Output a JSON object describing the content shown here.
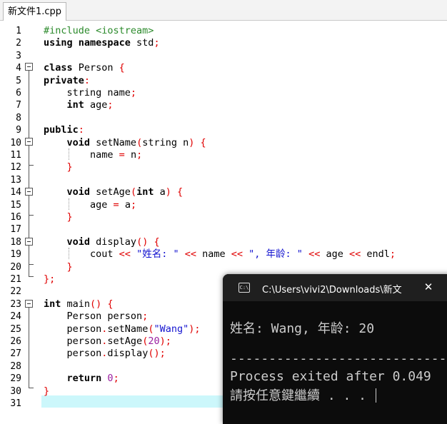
{
  "tab": {
    "title": "新文件1.cpp"
  },
  "lines": [
    {
      "n": "1",
      "tokens": [
        [
          "pp",
          "#include <iostream>"
        ]
      ]
    },
    {
      "n": "2",
      "tokens": [
        [
          "kw",
          "using namespace"
        ],
        [
          "plain",
          " std"
        ],
        [
          "op",
          ";"
        ]
      ]
    },
    {
      "n": "3",
      "tokens": []
    },
    {
      "n": "4",
      "tokens": [
        [
          "kw",
          "class"
        ],
        [
          "plain",
          " Person "
        ],
        [
          "op",
          "{"
        ]
      ]
    },
    {
      "n": "5",
      "tokens": [
        [
          "kw",
          "private"
        ],
        [
          "op",
          ":"
        ]
      ]
    },
    {
      "n": "6",
      "tokens": [
        [
          "plain",
          "    string name"
        ],
        [
          "op",
          ";"
        ]
      ]
    },
    {
      "n": "7",
      "tokens": [
        [
          "kw",
          "    int"
        ],
        [
          "plain",
          " age"
        ],
        [
          "op",
          ";"
        ]
      ]
    },
    {
      "n": "8",
      "tokens": []
    },
    {
      "n": "9",
      "tokens": [
        [
          "kw",
          "public"
        ],
        [
          "op",
          ":"
        ]
      ]
    },
    {
      "n": "10",
      "tokens": [
        [
          "kw",
          "    void"
        ],
        [
          "plain",
          " setName"
        ],
        [
          "op",
          "("
        ],
        [
          "plain",
          "string n"
        ],
        [
          "op",
          ") {"
        ]
      ]
    },
    {
      "n": "11",
      "tokens": [
        [
          "plain",
          "        name "
        ],
        [
          "op",
          "="
        ],
        [
          "plain",
          " n"
        ],
        [
          "op",
          ";"
        ]
      ]
    },
    {
      "n": "12",
      "tokens": [
        [
          "op",
          "    }"
        ]
      ]
    },
    {
      "n": "13",
      "tokens": []
    },
    {
      "n": "14",
      "tokens": [
        [
          "kw",
          "    void"
        ],
        [
          "plain",
          " setAge"
        ],
        [
          "op",
          "("
        ],
        [
          "kw",
          "int"
        ],
        [
          "plain",
          " a"
        ],
        [
          "op",
          ") {"
        ]
      ]
    },
    {
      "n": "15",
      "tokens": [
        [
          "plain",
          "        age "
        ],
        [
          "op",
          "="
        ],
        [
          "plain",
          " a"
        ],
        [
          "op",
          ";"
        ]
      ]
    },
    {
      "n": "16",
      "tokens": [
        [
          "op",
          "    }"
        ]
      ]
    },
    {
      "n": "17",
      "tokens": []
    },
    {
      "n": "18",
      "tokens": [
        [
          "kw",
          "    void"
        ],
        [
          "plain",
          " display"
        ],
        [
          "op",
          "() {"
        ]
      ]
    },
    {
      "n": "19",
      "tokens": [
        [
          "plain",
          "        cout "
        ],
        [
          "op",
          "<<"
        ],
        [
          "str",
          " \"姓名: \" "
        ],
        [
          "op",
          "<<"
        ],
        [
          "plain",
          " name "
        ],
        [
          "op",
          "<<"
        ],
        [
          "str",
          " \", 年龄: \" "
        ],
        [
          "op",
          "<<"
        ],
        [
          "plain",
          " age "
        ],
        [
          "op",
          "<<"
        ],
        [
          "plain",
          " endl"
        ],
        [
          "op",
          ";"
        ]
      ]
    },
    {
      "n": "20",
      "tokens": [
        [
          "op",
          "    }"
        ]
      ]
    },
    {
      "n": "21",
      "tokens": [
        [
          "op",
          "};"
        ]
      ]
    },
    {
      "n": "22",
      "tokens": []
    },
    {
      "n": "23",
      "tokens": [
        [
          "kw",
          "int"
        ],
        [
          "plain",
          " main"
        ],
        [
          "op",
          "() {"
        ]
      ]
    },
    {
      "n": "24",
      "tokens": [
        [
          "plain",
          "    Person person"
        ],
        [
          "op",
          ";"
        ]
      ]
    },
    {
      "n": "25",
      "tokens": [
        [
          "plain",
          "    person"
        ],
        [
          "op",
          "."
        ],
        [
          "plain",
          "setName"
        ],
        [
          "op",
          "("
        ],
        [
          "str",
          "\"Wang\""
        ],
        [
          "op",
          ");"
        ]
      ]
    },
    {
      "n": "26",
      "tokens": [
        [
          "plain",
          "    person"
        ],
        [
          "op",
          "."
        ],
        [
          "plain",
          "setAge"
        ],
        [
          "op",
          "("
        ],
        [
          "num",
          "20"
        ],
        [
          "op",
          ");"
        ]
      ]
    },
    {
      "n": "27",
      "tokens": [
        [
          "plain",
          "    person"
        ],
        [
          "op",
          "."
        ],
        [
          "plain",
          "display"
        ],
        [
          "op",
          "();"
        ]
      ]
    },
    {
      "n": "28",
      "tokens": []
    },
    {
      "n": "29",
      "tokens": [
        [
          "kw",
          "    return"
        ],
        [
          "plain",
          " "
        ],
        [
          "num",
          "0"
        ],
        [
          "op",
          ";"
        ]
      ]
    },
    {
      "n": "30",
      "tokens": [
        [
          "op",
          "}"
        ]
      ]
    },
    {
      "n": "31",
      "tokens": []
    }
  ],
  "console": {
    "title": "C:\\Users\\vivi2\\Downloads\\新文",
    "close": "✕",
    "output_line1": "姓名: Wang, 年龄: 20",
    "separator": "--------------------------------",
    "process_line": "Process exited after 0.049",
    "prompt_line": "請按任意鍵繼續 . . . "
  }
}
